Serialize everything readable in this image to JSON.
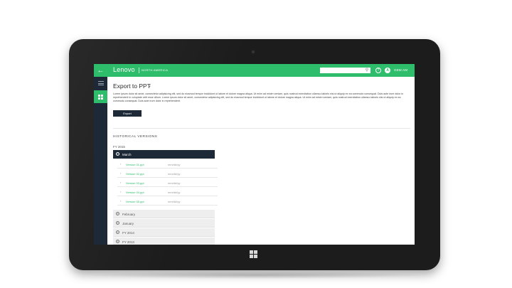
{
  "app": {
    "brand": "Lenovo",
    "region": "NORTH AMERICA",
    "username": "GEM AM",
    "avatar_initial": "A",
    "search": {
      "value": "",
      "placeholder": ""
    },
    "accent_color": "#2ebd6b",
    "dark_color": "#1e2937"
  },
  "icons": {
    "back": "back-arrow-icon",
    "menu": "hamburger-icon",
    "dashboard": "grid-icon",
    "search": "search-icon",
    "help": "help-icon",
    "windows": "windows-logo-icon"
  },
  "page": {
    "title": "Export to PPT",
    "description": "Lorem ipsum dolor sit amet, consectetur adipisicing elit, sed do eiusmod tempor incididunt ut labore et dolore magna aliqua. Ut enim ad minim veniam, quis nostrud exercitation ullamco laboris nisi ut aliquip ex ea commodo consequat. Duis aute irure dolor in reprehenderit in voluptate velit esse cillum. Lorem ipsum dolor sit amet, consectetur adipisicing elit, sed do eiusmod tempor incididunt ut labore et dolore magna aliqua. Ut enim ad minim veniam, quis nostrud exercitation ullamco laboris nisi ut aliquip ex ea commodo consequat. Duis aute irure dolor in reprehenderit.",
    "export_label": "Export"
  },
  "history": {
    "section_title": "HISTORICAL VERSIONS",
    "fiscal_year": "FY 2015",
    "open_month": "March",
    "versions": [
      {
        "name": "Version 01.ppt",
        "date": "mm/dd/yy"
      },
      {
        "name": "Version 02.ppt",
        "date": "mm/dd/yy"
      },
      {
        "name": "Version 03.ppt",
        "date": "mm/dd/yy"
      },
      {
        "name": "Version 04.ppt",
        "date": "mm/dd/yy"
      },
      {
        "name": "Version 05.ppt",
        "date": "mm/dd/yy"
      }
    ],
    "collapsed": [
      {
        "label": "February"
      },
      {
        "label": "January"
      },
      {
        "label": "FY 2014"
      },
      {
        "label": "FY 2013"
      }
    ]
  }
}
